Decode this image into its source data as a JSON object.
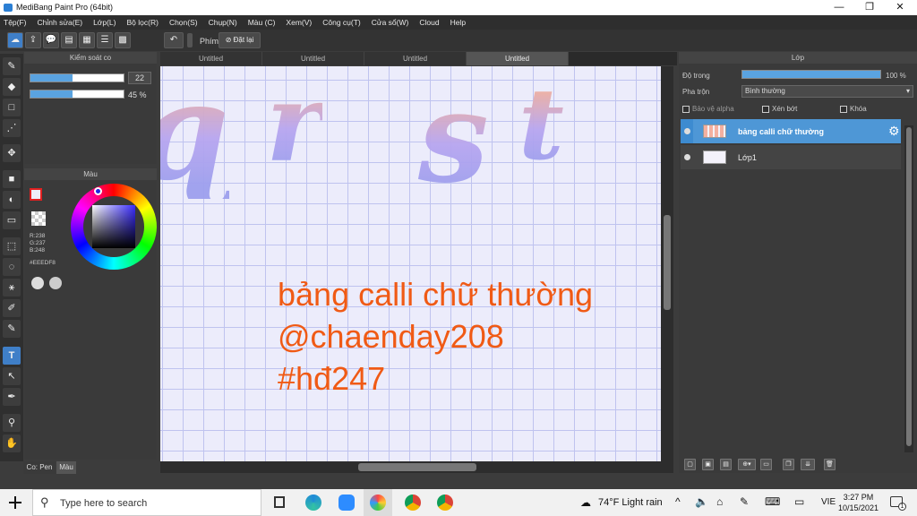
{
  "window": {
    "title": "MediBang Paint Pro (64bit)",
    "min": "—",
    "max": "❐",
    "close": "✕"
  },
  "menu": [
    "Tệp(F)",
    "Chỉnh sửa(E)",
    "Lớp(L)",
    "Bộ lọc(R)",
    "Chọn(S)",
    "Chụp(N)",
    "Màu (C)",
    "Xem(V)",
    "Công cụ(T)",
    "Cửa sổ(W)",
    "Cloud",
    "Help"
  ],
  "toolbar": {
    "phim_label": "Phím",
    "reset_label": "Đặt lại"
  },
  "brush_panel": {
    "title": "Kiểm soát co",
    "size_value": "22",
    "opacity_value": "45 %",
    "size_fraction": 0.45,
    "opacity_fraction": 0.45
  },
  "color_panel": {
    "title": "Màu",
    "r": "R:238",
    "g": "G:237",
    "b": "B:248",
    "hex": "#EEEDF8"
  },
  "bottom_tabs": {
    "pen": "Co: Pen",
    "color": "Màu"
  },
  "tabs": [
    "Untitled",
    "Untitled",
    "Untitled",
    "Untitled"
  ],
  "canvas": {
    "line1": "bảng calli chữ thường",
    "line2": "@chaenday208",
    "line3": "#hđ247",
    "text_color": "#f05a15"
  },
  "layer_panel": {
    "title": "Lớp",
    "opacity_label": "Độ trong",
    "opacity_value": "100 %",
    "blend_label": "Pha trộn",
    "blend_value": "Bình thường",
    "protect_alpha": "Bảo vệ alpha",
    "clip": "Xén bớt",
    "lock": "Khóa",
    "layers": [
      {
        "name": "bảng calli chữ thường",
        "selected": true
      },
      {
        "name": "Lớp1",
        "selected": false
      }
    ]
  },
  "taskbar": {
    "search_placeholder": "Type here to search",
    "weather": "74°F  Light rain",
    "lang": "VIE",
    "time": "3:27 PM",
    "date": "10/15/2021",
    "notifications": "1"
  }
}
